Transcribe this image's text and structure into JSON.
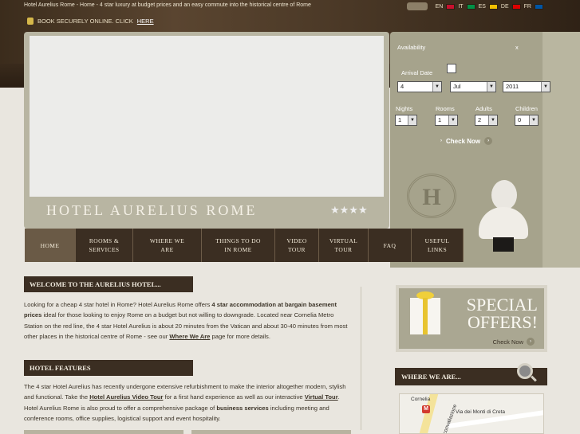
{
  "header": {
    "tagline": "Hotel Aurelius Rome - Home - 4 star luxury at budget prices and an easy commute into the historical centre of Rome",
    "secure_text": "BOOK SECURELY ONLINE. CLICK",
    "secure_link": "HERE"
  },
  "languages": [
    {
      "code": "EN",
      "color": "#c8102e"
    },
    {
      "code": "IT",
      "color": "#009246"
    },
    {
      "code": "ES",
      "color": "#f1bf00"
    },
    {
      "code": "DE",
      "color": "#dd0000"
    },
    {
      "code": "FR",
      "color": "#0055a4"
    }
  ],
  "hero": {
    "hotel_name": "HOTEL AURELIUS ROME",
    "stars": "★★★★"
  },
  "availability": {
    "title": "Availability",
    "close": "x",
    "arrival_label": "Arrival Date",
    "day": "4",
    "month": "Jul",
    "year": "2011",
    "nights_label": "Nights",
    "nights": "1",
    "rooms_label": "Rooms",
    "rooms": "1",
    "adults_label": "Adults",
    "adults": "2",
    "children_label": "Children",
    "children": "0",
    "check_label": "Check Now",
    "emblem": "H"
  },
  "nav": [
    {
      "l1": "HOME",
      "l2": "",
      "w": 64
    },
    {
      "l1": "ROOMS &",
      "l2": "SERVICES",
      "w": 72
    },
    {
      "l1": "WHERE WE",
      "l2": "ARE",
      "w": 86
    },
    {
      "l1": "THINGS TO DO",
      "l2": "IN ROME",
      "w": 92
    },
    {
      "l1": "VIDEO",
      "l2": "TOUR",
      "w": 55
    },
    {
      "l1": "VIRTUAL",
      "l2": "TOUR",
      "w": 62
    },
    {
      "l1": "FAQ",
      "l2": "",
      "w": 54
    },
    {
      "l1": "USEFUL",
      "l2": "LINKS",
      "w": 65
    }
  ],
  "welcome": {
    "title": "WELCOME TO THE AURELIUS HOTEL...",
    "p1": "Looking for a cheap 4 star hotel in Rome? Hotel Aurelius Rome offers ",
    "b1": "4 star accommodation at bargain basement prices",
    "p2": " ideal for those looking to enjoy Rome on a budget but not willing to downgrade. Located near Cornelia Metro Station on the red line, the 4 star Hotel Aurelius is about 20 minutes from the Vatican and about 30-40 minutes from most other places in the historical centre of Rome - see our ",
    "link": "Where We Are",
    "p3": " page for more details."
  },
  "features": {
    "title": "HOTEL FEATURES",
    "p1": "The 4 star Hotel Aurelius has recently undergone extensive refurbishment to make the interior altogether modern, stylish and functional. Take the ",
    "link1": "Hotel Aurelius Video Tour",
    "p2": " for a first hand experience as well as our interactive ",
    "link2": "Virtual Tour",
    "p3": ". Hotel Aurelius Rome is also proud to offer a comprehensive package of ",
    "b1": "business services",
    "p4": " including meeting and conference rooms, office supplies, logistical support and event hospitality."
  },
  "offers": {
    "title": "SPECIAL OFFERS!",
    "check_label": "Check Now"
  },
  "where": {
    "title": "WHERE WE ARE...",
    "map_metro": "M",
    "map_label1": "Cornelia",
    "map_label2": "Via dei Monti di Creta",
    "map_label3": "Circonvallazione"
  }
}
